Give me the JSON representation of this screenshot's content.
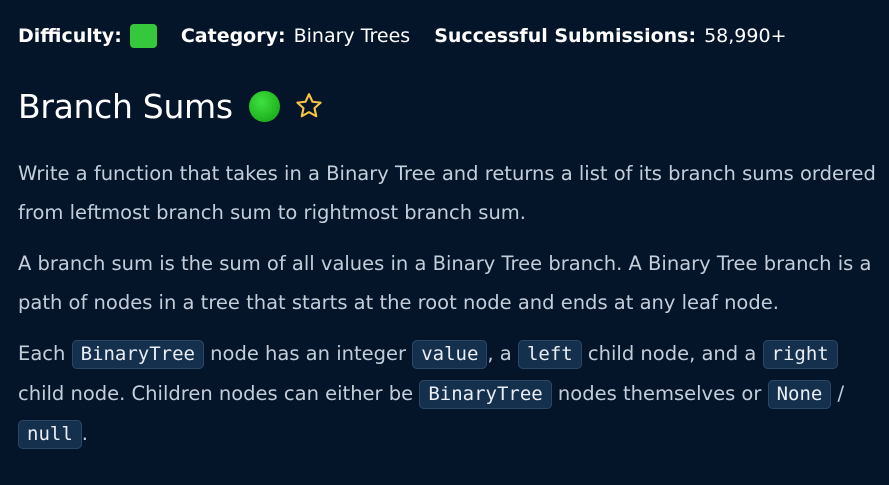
{
  "meta": {
    "difficulty_label": "Difficulty:",
    "category_label": "Category:",
    "category_value": "Binary Trees",
    "submissions_label": "Successful Submissions:",
    "submissions_value": "58,990+",
    "difficulty_color": "#35c83c"
  },
  "question": {
    "title": "Branch Sums",
    "status_color": "#2bc82b",
    "favorite_icon": "star-outline-icon"
  },
  "description": {
    "p1": "Write a function that takes in a Binary Tree and returns a list of its branch sums ordered from leftmost branch sum to rightmost branch sum.",
    "p2": "A branch sum is the sum of all values in a Binary Tree branch. A Binary Tree branch is a path of nodes in a tree that starts at the root node and ends at any leaf node.",
    "p3": {
      "t1": "Each ",
      "c1": "BinaryTree",
      "t2": " node has an integer ",
      "c2": "value",
      "t3": ", a ",
      "c3": "left",
      "t4": " child node, and a ",
      "c4": "right",
      "t5": " child node. Children nodes can either be ",
      "c5": "BinaryTree",
      "t6": " nodes themselves or ",
      "c6": "None",
      "t7": " / ",
      "c7": "null",
      "t8": "."
    }
  }
}
